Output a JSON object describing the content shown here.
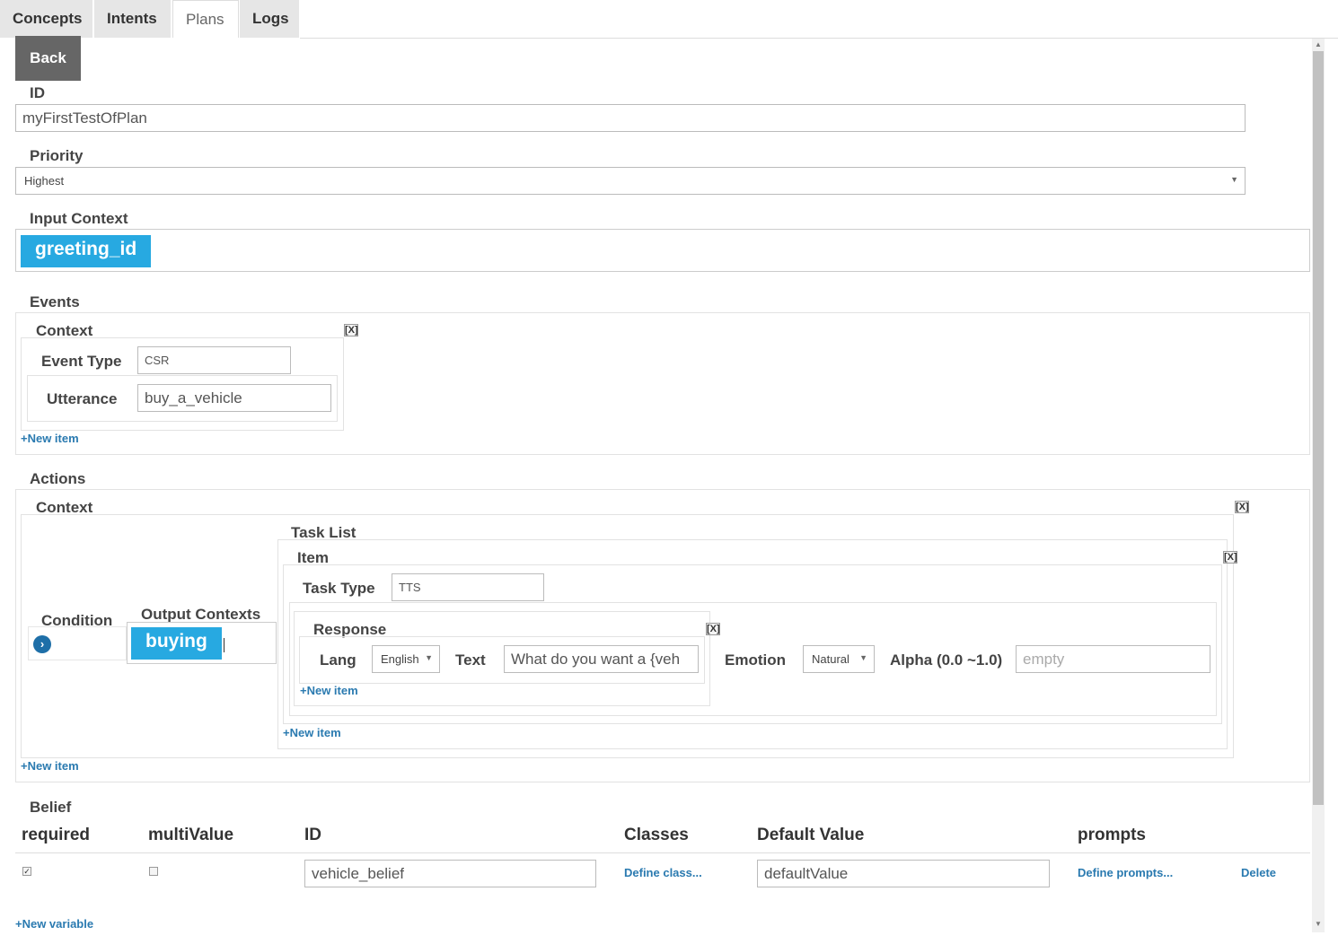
{
  "tabs": {
    "concepts": "Concepts",
    "intents": "Intents",
    "plans": "Plans",
    "logs": "Logs"
  },
  "back_label": "Back",
  "form": {
    "id_label": "ID",
    "id_value": "myFirstTestOfPlan",
    "priority_label": "Priority",
    "priority_value": "Highest",
    "input_context_label": "Input Context",
    "input_context_chip": "greeting_id"
  },
  "events": {
    "label": "Events",
    "context_label": "Context",
    "remove_label": "[X]",
    "event_type_label": "Event Type",
    "event_type_value": "CSR",
    "utterance_label": "Utterance",
    "utterance_value": "buy_a_vehicle",
    "new_item_label": "+New item"
  },
  "actions": {
    "label": "Actions",
    "context_label": "Context",
    "remove_label": "[X]",
    "condition_label": "Condition",
    "output_contexts_label": "Output Contexts",
    "output_context_chip": "buying",
    "task_list_label": "Task List",
    "item_label": "Item",
    "item_remove_label": "[X]",
    "task_type_label": "Task Type",
    "task_type_value": "TTS",
    "response_label": "Response",
    "response_remove_label": "[X]",
    "lang_label": "Lang",
    "lang_value": "English",
    "text_label": "Text",
    "text_value": "What do you want a {veh",
    "emotion_label": "Emotion",
    "emotion_value": "Natural",
    "alpha_label": "Alpha (0.0 ~1.0)",
    "alpha_placeholder": "empty",
    "response_new_item": "+New item",
    "task_new_item": "+New item",
    "actions_new_item": "+New item"
  },
  "belief": {
    "label": "Belief",
    "headers": {
      "required": "required",
      "multi_value": "multiValue",
      "id": "ID",
      "classes": "Classes",
      "default_value": "Default Value",
      "prompts": "prompts"
    },
    "row": {
      "required_checked": true,
      "multi_value_checked": false,
      "id_value": "vehicle_belief",
      "classes_link": "Define class...",
      "default_value": "defaultValue",
      "prompts_link": "Define prompts...",
      "delete_link": "Delete"
    },
    "new_variable_label": "+New variable"
  }
}
